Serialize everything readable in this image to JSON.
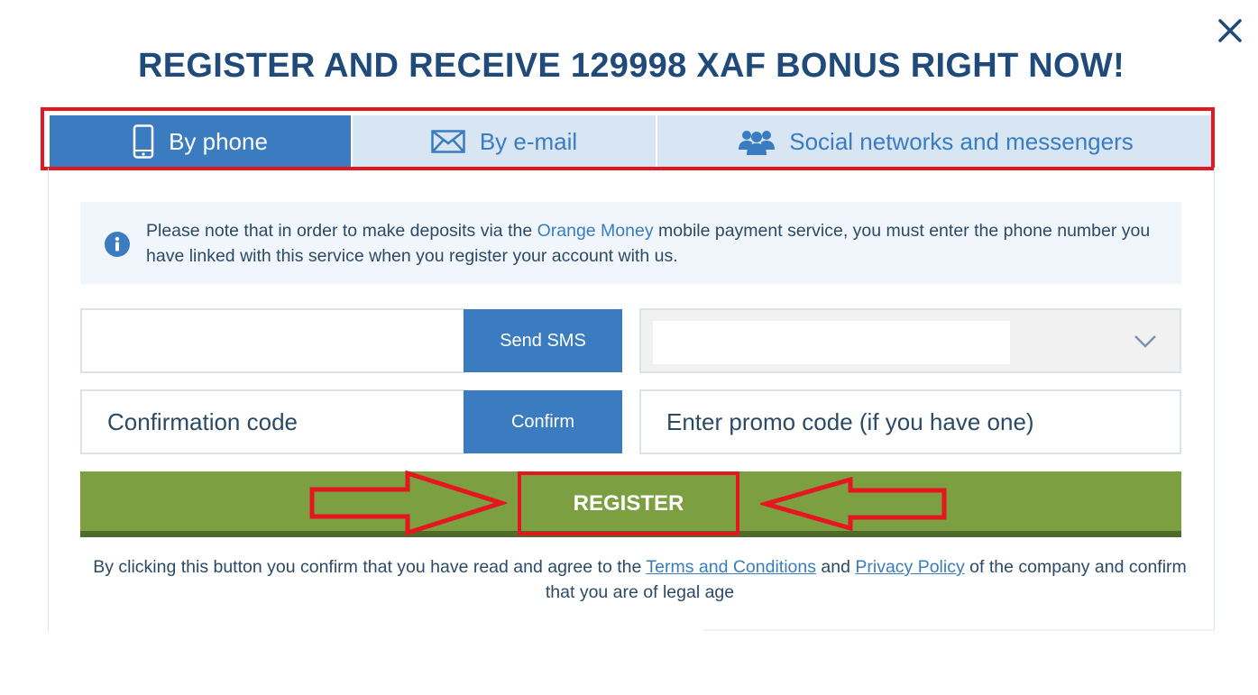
{
  "modal": {
    "title": "REGISTER AND RECEIVE 129998 XAF BONUS RIGHT NOW!",
    "close_icon": "close-icon"
  },
  "tabs": [
    {
      "label": "By phone",
      "icon": "phone-icon",
      "active": true
    },
    {
      "label": "By e-mail",
      "icon": "envelope-icon",
      "active": false
    },
    {
      "label": "Social networks and messengers",
      "icon": "users-icon",
      "active": false
    }
  ],
  "info": {
    "text_before": "Please note that in order to make deposits via the ",
    "link": "Orange Money",
    "text_after": " mobile payment service, you must enter the phone number you have linked with this service when you register your account with us."
  },
  "form": {
    "phone_value": "",
    "send_sms_label": "Send SMS",
    "currency_value": "",
    "code_placeholder": "Confirmation code",
    "confirm_label": "Confirm",
    "promo_placeholder": "Enter promo code (if you have one)",
    "register_label": "REGISTER"
  },
  "terms": {
    "text_before": "By clicking this button you confirm that you have read and agree to the ",
    "terms_link": "Terms and Conditions",
    "text_mid": " and ",
    "privacy_link": "Privacy Policy",
    "text_after": " of the company and confirm that you are of legal age"
  },
  "colors": {
    "title": "#1f4a7a",
    "primary": "#3a7cbf",
    "tab_inactive": "#d8e6f3",
    "register": "#7c9f41",
    "highlight": "#e5161f"
  }
}
